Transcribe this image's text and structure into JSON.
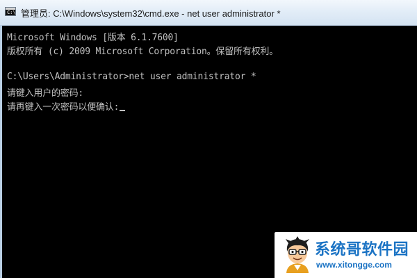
{
  "window": {
    "title": "管理员: C:\\Windows\\system32\\cmd.exe - net  user administrator *",
    "icon": "cmd-icon",
    "icon_text": "C:\\"
  },
  "console": {
    "lines": [
      "Microsoft Windows [版本 6.1.7600]",
      "版权所有 (c) 2009 Microsoft Corporation。保留所有权利。",
      "",
      "C:\\Users\\Administrator>net user administrator *",
      "请键入用户的密码:",
      "请再键入一次密码以便确认:"
    ],
    "text_color": "#c0c0c0",
    "background": "#000000"
  },
  "watermark": {
    "title": "系统哥软件园",
    "url": "www.xitongge.com",
    "color": "#1b73c4",
    "mascot_icon": "cartoon-mascot-icon"
  }
}
